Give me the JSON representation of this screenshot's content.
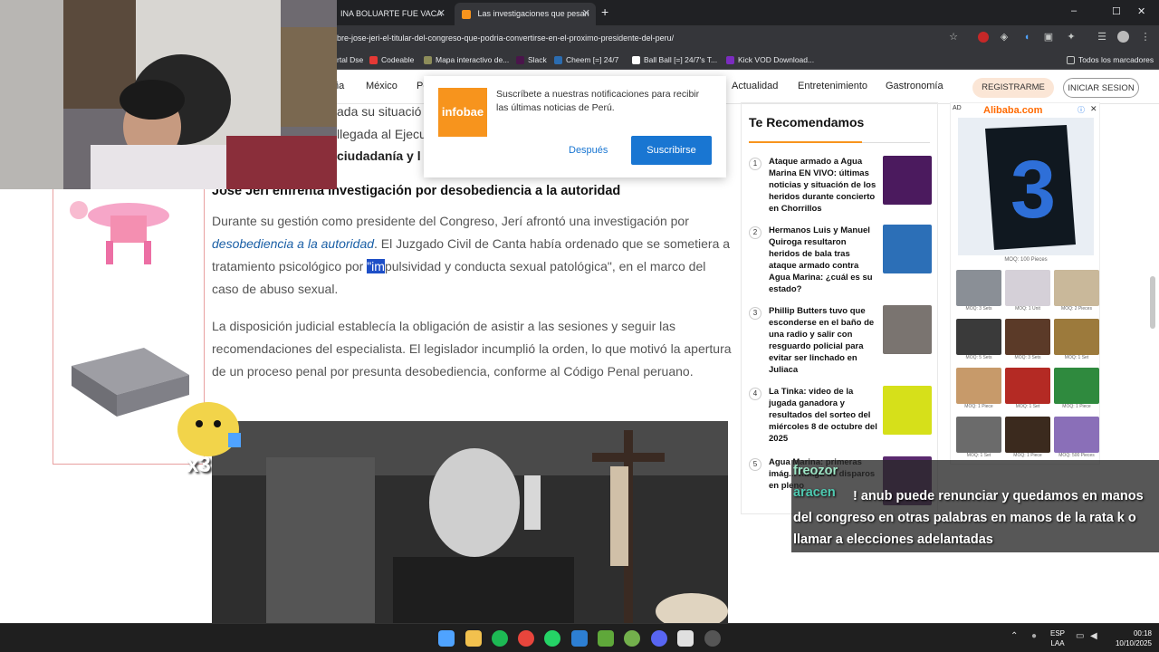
{
  "browser": {
    "tabs": [
      {
        "label": "INA BOLUARTE FUE VACA",
        "active": false
      },
      {
        "label": "Las investigaciones que pesan",
        "active": true
      }
    ],
    "new_tab": "+",
    "url": "bre-jose-jeri-el-titular-del-congreso-que-podria-convertirse-en-el-proximo-presidente-del-peru/",
    "window_controls": {
      "minimize": "–",
      "maximize": "☐",
      "close": "✕"
    },
    "bookmarks": [
      {
        "label": "rtal Dse",
        "color": "#555555"
      },
      {
        "label": "Codeable",
        "color": "#e53935"
      },
      {
        "label": "Mapa interactivo de...",
        "color": "#8d8d5a"
      },
      {
        "label": "Slack",
        "color": "#4a154b"
      },
      {
        "label": "Cheem [=] 24/7",
        "color": "#2b6cb0"
      },
      {
        "label": "Ball Ball [=] 24/7's T...",
        "color": "#ffffff"
      },
      {
        "label": "Kick VOD Download...",
        "color": "#7b2cbf"
      }
    ],
    "bookmarks_all": "Todos los marcadores"
  },
  "site_nav": {
    "partial_left": "ña",
    "items": [
      "México",
      "Pe",
      "Actualidad",
      "Entretenimiento",
      "Gastronomía"
    ],
    "register": "REGISTRARME",
    "login": "INICIAR SESION"
  },
  "notification": {
    "logo": "infobae",
    "message": "Suscríbete a nuestras notificaciones para recibir las últimas noticias de Perú.",
    "later": "Después",
    "subscribe": "Suscribirse"
  },
  "article": {
    "fragment1": "ada su situació",
    "fragment2": "llegada al Ejecu",
    "fragment3": "ciudadanía y l",
    "heading": "José Jerí enfrenta investigación por desobediencia a la autoridad",
    "p1_a": "Durante su gestión como presidente del Congreso, Jerí afrontó una investigación por ",
    "p1_link": "desobediencia a la autoridad",
    "p1_b": ". El Juzgado Civil de Canta había ordenado que se sometiera a tratamiento psicológico por ",
    "p1_hl": "\"im",
    "p1_c": "pulsividad y conducta sexual patológica\", en el marco del caso de abuso sexual.",
    "p2": "La disposición judicial establecía la obligación de asistir a las sesiones y seguir las recomendaciones del especialista. El legislador incumplió la orden, lo que motivó la apertura de un proceso penal por presunta desobediencia, conforme al Código Penal peruano."
  },
  "recommend": {
    "title": "Te Recomendamos",
    "items": [
      {
        "num": "1",
        "text": "Ataque armado a Agua Marina EN VIVO: últimas noticias y situación de los heridos durante concierto en Chorrillos",
        "color": "#4b1a5e"
      },
      {
        "num": "2",
        "text": "Hermanos Luis y Manuel Quiroga resultaron heridos de bala tras ataque armado contra Agua Marina: ¿cuál es su estado?",
        "color": "#2c6fb7"
      },
      {
        "num": "3",
        "text": "Phillip Butters tuvo que esconderse en el baño de una radio y salir con resguardo policial para evitar ser linchado en Juliaca",
        "color": "#7a7470"
      },
      {
        "num": "4",
        "text": "La Tinka: video de la jugada ganadora y resultados del sorteo del miércoles 8 de octubre del 2025",
        "color": "#d6e01a"
      },
      {
        "num": "5",
        "text": "Agua Marina: primeras imág... ráfaga de disparos en pleno",
        "color": "#5a2a6e"
      }
    ]
  },
  "ad": {
    "label": "AD",
    "brand": "Alibaba.com",
    "main_caption": "MOQ: 100 Pieces",
    "cells": [
      {
        "cap": "MOQ: 3 Sets",
        "color": "#8a8f96"
      },
      {
        "cap": "MOQ: 1 Unit",
        "color": "#d5d0d8"
      },
      {
        "cap": "MOQ: 2 Pieces",
        "color": "#c9b89a"
      },
      {
        "cap": "MOQ: 5 Sets",
        "color": "#3a3a3a"
      },
      {
        "cap": "MOQ: 3 Sets",
        "color": "#5b3a28"
      },
      {
        "cap": "MOQ: 1 Set",
        "color": "#9c7a3c"
      },
      {
        "cap": "MOQ: 1 Piece",
        "color": "#c79a6a"
      },
      {
        "cap": "MOQ: 1 Set",
        "color": "#b42a24"
      },
      {
        "cap": "MOQ: 1 Piece",
        "color": "#2f8a3e"
      },
      {
        "cap": "MOQ: 1 Set",
        "color": "#6b6b6b"
      },
      {
        "cap": "MOQ: 1 Piece",
        "color": "#3b2a1e"
      },
      {
        "cap": "MOQ: 500 Pieces",
        "color": "#8a6fb8"
      }
    ]
  },
  "overlay": {
    "emote_count": "x3",
    "chat_user1": "freozor",
    "chat_user2": "aracen",
    "chat_lines": [
      "! anub puede renunciar y quedamos en manos",
      "del congreso en otras palabras en manos de la rata k o",
      "llamar a elecciones adelantadas"
    ]
  },
  "taskbar": {
    "lang": "ESP",
    "lang2": "LAA",
    "time": "00:18",
    "date": "10/10/2025"
  },
  "colors": {
    "accent_blue": "#1976d2",
    "infobae_orange": "#f7941d",
    "register_bg": "#fbe6d6"
  }
}
